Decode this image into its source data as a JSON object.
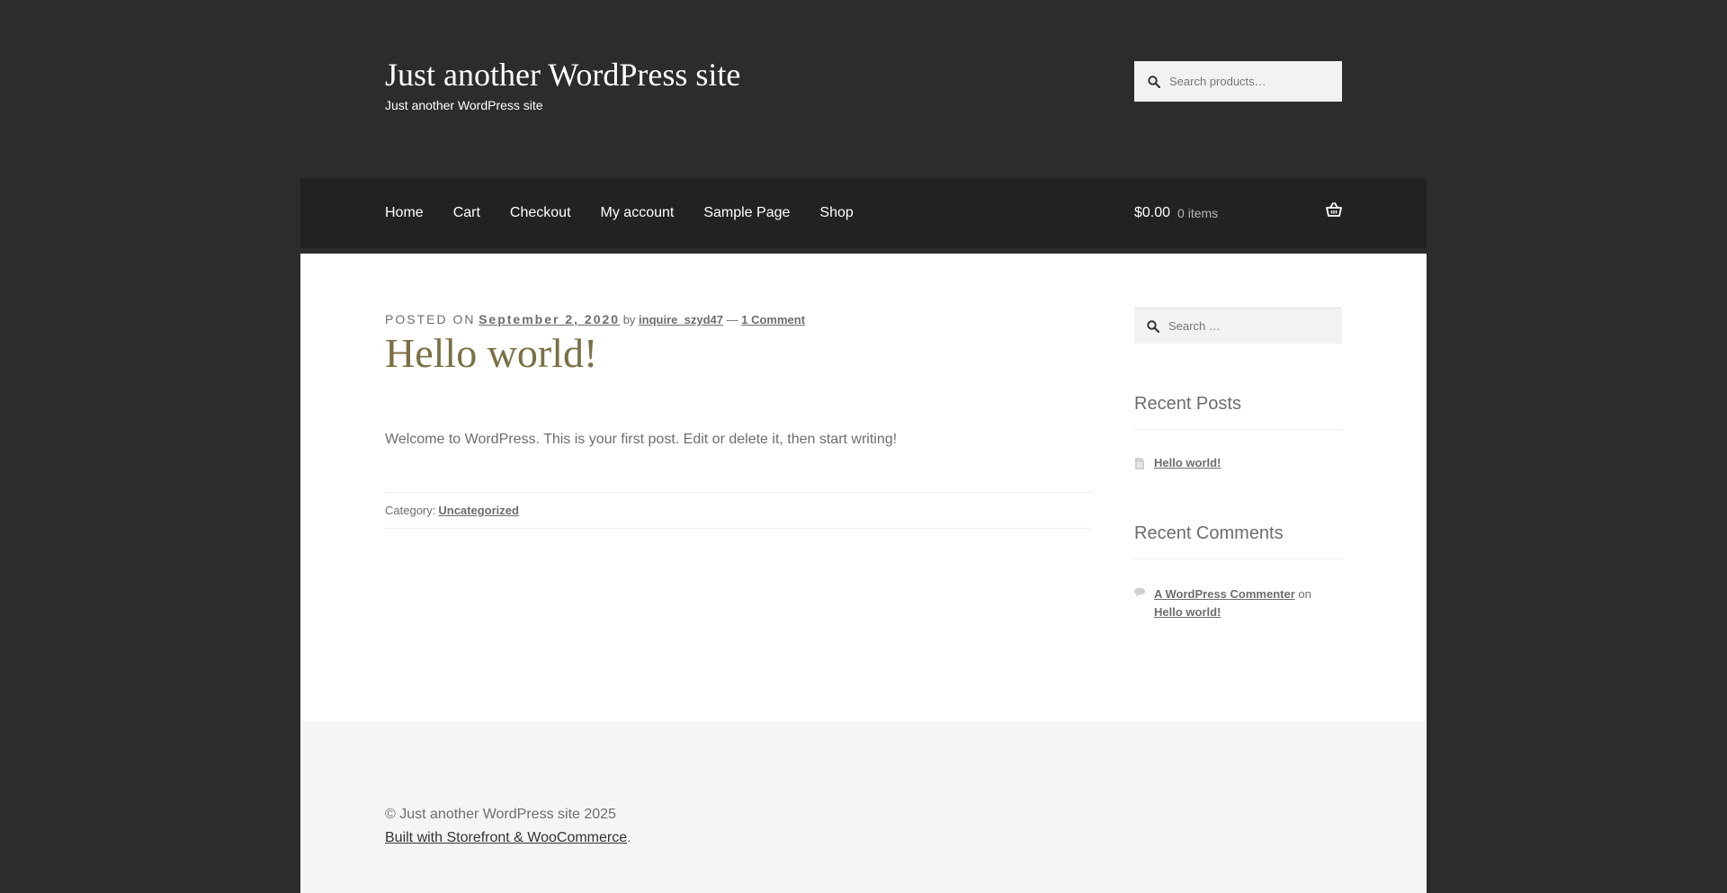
{
  "header": {
    "site_title": "Just another WordPress site",
    "tagline": "Just another WordPress site",
    "search_placeholder": "Search products…"
  },
  "nav": {
    "items": [
      "Home",
      "Cart",
      "Checkout",
      "My account",
      "Sample Page",
      "Shop"
    ]
  },
  "cart": {
    "amount": "$0.00",
    "count": "0 items"
  },
  "post": {
    "posted_on_label": "Posted on",
    "date": "September 2, 2020",
    "by_label": "by",
    "author": "inquire_szyd47",
    "separator": "—",
    "comments_link": "1 Comment",
    "title": "Hello world!",
    "content": "Welcome to WordPress. This is your first post. Edit or delete it, then start writing!",
    "category_label": "Category:",
    "category": "Uncategorized"
  },
  "sidebar": {
    "search_placeholder": "Search …",
    "recent_posts_title": "Recent Posts",
    "recent_posts": [
      "Hello world!"
    ],
    "recent_comments_title": "Recent Comments",
    "comment_author": "A WordPress Commenter",
    "comment_on": "on",
    "comment_post": "Hello world!"
  },
  "footer": {
    "copyright": "© Just another WordPress site 2025",
    "built_with": "Built with Storefront & WooCommerce",
    "built_with_suffix": "."
  },
  "colors": {
    "header_bg": "#2c2c2c",
    "nav_bg": "#222222",
    "title_accent": "#7b7045",
    "footer_bg": "#f5f5f5"
  }
}
